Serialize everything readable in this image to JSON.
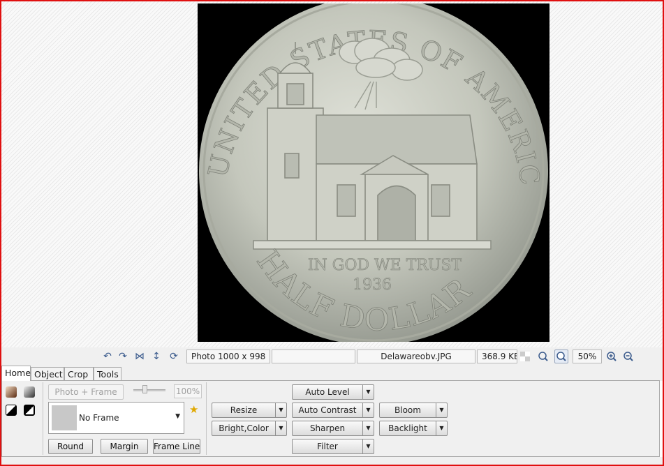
{
  "status": {
    "photo_size": "Photo 1000 x 998",
    "empty_field": "",
    "filename": "Delawareobv.JPG",
    "filesize": "368.9 KB",
    "zoom": "50%",
    "icons": [
      "rotate-left-icon",
      "rotate-right-icon",
      "flip-horizontal-icon",
      "flip-vertical-icon",
      "reset-icon",
      "checkerboard-icon",
      "actual-size-icon",
      "fit-to-window-icon",
      "zoom-in-icon",
      "zoom-out-icon"
    ]
  },
  "tabs": [
    "Home",
    "Object",
    "Crop",
    "Tools"
  ],
  "active_tab": "Home",
  "frame_group": {
    "photo_frame_label": "Photo + Frame",
    "opacity": "100%",
    "frame_name": "No Frame",
    "round_label": "Round",
    "margin_label": "Margin",
    "frame_line_label": "Frame Line"
  },
  "adjust_group": {
    "auto_level": "Auto Level",
    "auto_contrast": "Auto Contrast",
    "resize": "Resize",
    "bloom": "Bloom",
    "bright_color": "Bright,Color",
    "sharpen": "Sharpen",
    "backlight": "Backlight",
    "filter": "Filter"
  },
  "coin": {
    "top_legend": "UNITED STATES OF AMERICA",
    "motto": "IN GOD WE TRUST",
    "year": "1936",
    "denomination": "HALF DOLLAR"
  },
  "colors": {
    "border": "#e01010",
    "photo_bg": "#000000",
    "coin": "#c9ccc2",
    "ribbon_bg": "#f0f0f0"
  }
}
